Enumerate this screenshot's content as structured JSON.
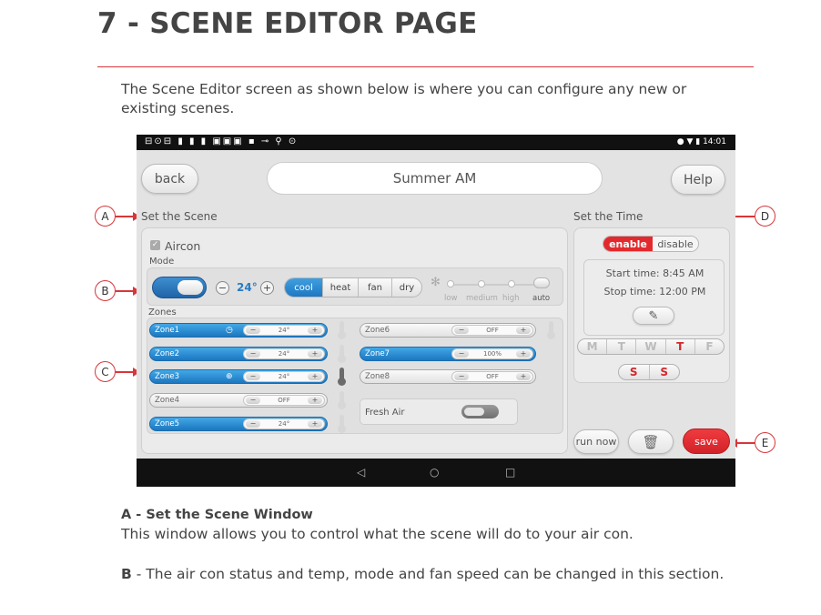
{
  "document": {
    "title": "7 - SCENE EDITOR PAGE",
    "intro": "The Scene Editor screen as shown below is where you can configure any new or existing scenes.",
    "section_a_heading": "A - Set the Scene Window",
    "section_a_text": "This window allows you to control what the scene will do to your air con.",
    "section_b_letter": "B",
    "section_b_text": " - The air con status and temp, mode and fan speed can be changed in this section."
  },
  "callouts": [
    "A",
    "B",
    "C",
    "D",
    "E"
  ],
  "accent_color": "#d8363a",
  "tablet": {
    "status_time": "14:01",
    "header": {
      "back_label": "back",
      "scene_name": "Summer AM",
      "help_label": "Help"
    },
    "set_scene_label": "Set the Scene",
    "set_time_label": "Set the Time",
    "aircon": {
      "label": "Aircon",
      "checked": true,
      "mode_label": "Mode",
      "power_on": true,
      "minus": "−",
      "plus": "+",
      "temp": "24°",
      "modes": [
        "cool",
        "heat",
        "fan",
        "dry"
      ],
      "selected_mode": "cool",
      "fan_speeds": [
        "low",
        "medium",
        "high",
        "auto"
      ],
      "selected_fan": "auto"
    },
    "zones_label": "Zones",
    "zones": [
      {
        "name": "Zone1",
        "value": "24°",
        "on": true
      },
      {
        "name": "Zone2",
        "value": "24°",
        "on": true
      },
      {
        "name": "Zone3",
        "value": "24°",
        "on": true
      },
      {
        "name": "Zone4",
        "value": "OFF",
        "on": false
      },
      {
        "name": "Zone5",
        "value": "24°",
        "on": true
      },
      {
        "name": "Zone6",
        "value": "OFF",
        "on": false
      },
      {
        "name": "Zone7",
        "value": "100%",
        "on": true
      },
      {
        "name": "Zone8",
        "value": "OFF",
        "on": false
      }
    ],
    "fresh_air": {
      "label": "Fresh Air",
      "on": false
    },
    "time": {
      "enable_label": "enable",
      "disable_label": "disable",
      "enabled": true,
      "start": "Start time: 8:45 AM",
      "stop": "Stop time: 12:00 PM",
      "days": [
        "M",
        "T",
        "W",
        "T",
        "F"
      ],
      "active_days": [
        3
      ],
      "weekend": [
        "S",
        "S"
      ]
    },
    "footer": {
      "run_now_label": "run now",
      "save_label": "save"
    }
  }
}
